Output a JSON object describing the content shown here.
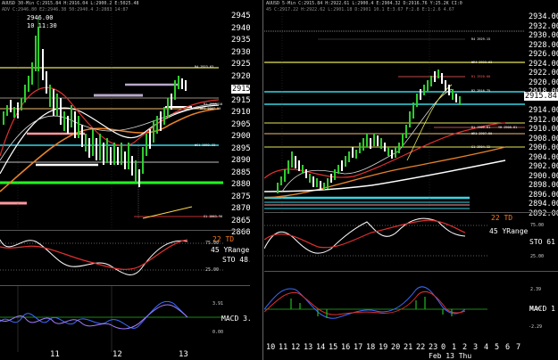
{
  "left_chart": {
    "header": "AUUSD 30-Min C:2915.84 H:2916.04 L:2900.2 E:5025.48",
    "header_line2": "ADV C:2946.80 E2:2946.38 50:2940.4 J:2883 14:87",
    "high_label": "2946.00",
    "time_label": "10 11:30",
    "price_tag": "2915.84",
    "y_ticks": [
      "2945.00",
      "2940.00",
      "2935.00",
      "2930.00",
      "2925.00",
      "2920.00",
      "2915.00",
      "2910.00",
      "2905.00",
      "2900.00",
      "2895.00",
      "2890.00",
      "2885.00",
      "2880.00",
      "2875.00",
      "2870.00",
      "2865.00",
      "2860.00"
    ],
    "x_ticks": [
      "11",
      "12",
      "13"
    ],
    "levels": [
      "R4 2923.63",
      "R1 2909.10",
      "WR1 2907.50",
      "WS1 2892.33",
      "S1 2863.90"
    ],
    "sto_label": "STO  48.",
    "macd_label": "MACD  3.",
    "td_label": "22 TD",
    "yrange_label": "45 YRange",
    "right_ticks": [
      "75.00",
      "25.00",
      "3.91",
      "0.00"
    ]
  },
  "right_chart": {
    "header": "AUUSD 5-Min C:2915.84 H:2922.61 L:2900.4 E:2904.32 D:2916.76 Y:25.2K CI:0",
    "header_line2": "45 C:2917.22 H:2922.62 L:2901.18 D:2901 10.1 E:3.67 F:2.8 E:1:2.6 4.67",
    "price_tag": "2915.84",
    "y_ticks": [
      "2934.00",
      "2932.00",
      "2930.00",
      "2928.00",
      "2926.00",
      "2924.00",
      "2922.00",
      "2920.00",
      "2918.00",
      "2916.00",
      "2914.00",
      "2912.00",
      "2910.00",
      "2908.00",
      "2906.00",
      "2904.00",
      "2902.00",
      "2900.00",
      "2898.00",
      "2896.00",
      "2894.00",
      "2892.00"
    ],
    "x_ticks": [
      "10",
      "11",
      "12",
      "13",
      "14",
      "15",
      "16",
      "17",
      "18",
      "19",
      "20",
      "21",
      "22",
      "23",
      "0",
      "1",
      "2",
      "3",
      "4",
      "5",
      "6",
      "7"
    ],
    "date_label": "Feb 13 Thu",
    "levels": [
      "R4 2929.15",
      "WR4 2923.63",
      "R1 2920.60",
      "R2 2916.75",
      "R1 2909.61",
      "YH 2908.81",
      "WR1 2907.50",
      "S1 2904.32"
    ],
    "sto_label": "STO  61",
    "macd_label": "MACD  1",
    "td_label": "22 TD",
    "yrange_label": "45 YRange",
    "right_ticks": [
      "75.00",
      "25.00",
      "2.39",
      "0.00",
      "-2.29"
    ]
  },
  "colors": {
    "background": "#000000",
    "bull_candle": "#2ecc2e",
    "bear_candle": "#ffffff",
    "yellow_level": "#e6e65a",
    "cyan_level": "#39d6e6",
    "orange_ma": "#e8822a",
    "red_ma": "#e03030",
    "macd_blue": "#3b6cff",
    "macd_purple": "#a37bff",
    "green_hist": "#23b523"
  }
}
